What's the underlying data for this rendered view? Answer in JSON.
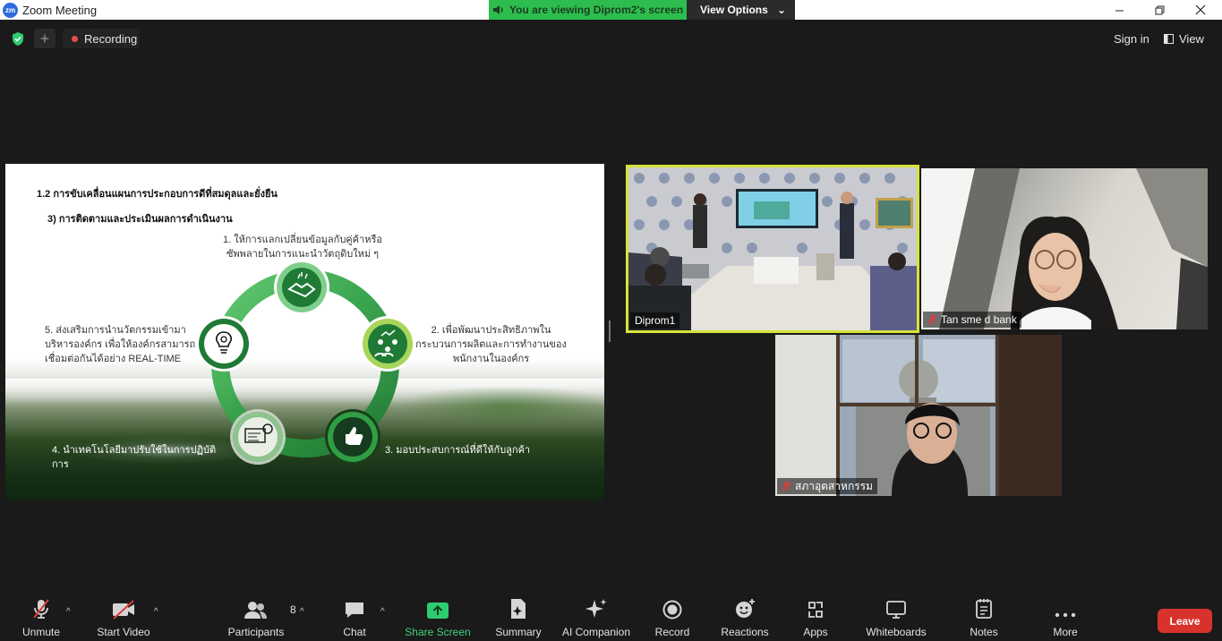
{
  "window": {
    "title": "Zoom Meeting",
    "logo_text": "zm",
    "banner_text": "You are viewing Diprom2's screen",
    "view_options_label": "View Options"
  },
  "topbar": {
    "recording_label": "Recording",
    "signin_label": "Sign in",
    "view_label": "View"
  },
  "slide": {
    "heading": "1.2 การขับเคลื่อนแผนการประกอบการดีที่สมดุลและยั่งยืน",
    "subheading": "3)  การติดตามและประเมินผลการดำเนินงาน",
    "items": [
      {
        "line1": "1. ให้การแลกเปลี่ยนข้อมูลกับคู่ค้าหรือ",
        "line2": "ซัพพลายในการแนะนำวัตถุดิบใหม่ ๆ"
      },
      {
        "line1": "2. เพื่อพัฒนาประสิทธิภาพใน",
        "line2": "กระบวนการผลิตและการทำงานของ",
        "line3": "พนักงานในองค์กร"
      },
      {
        "line1": "3. มอบประสบการณ์ที่ดีให้กับลูกค้า"
      },
      {
        "line1": "4. นำเทคโนโลยีมาปรับใช้ในการปฏิบัติการ"
      },
      {
        "line1": "5. ส่งเสริมการนำนวัตกรรมเข้ามา",
        "line2": "บริหารองค์กร เพื่อให้องค์กรสามารถ",
        "line3": "เชื่อมต่อกันได้อย่าง REAL-TIME"
      }
    ]
  },
  "participants_tiles": [
    {
      "name": "Diprom1",
      "muted": false
    },
    {
      "name": "Tan sme d bank",
      "muted": true
    },
    {
      "name": "สภาอุตสาหกรรม",
      "muted": true
    }
  ],
  "toolbar": {
    "unmute": "Unmute",
    "start_video": "Start Video",
    "participants": "Participants",
    "participants_count": "8",
    "chat": "Chat",
    "share_screen": "Share Screen",
    "summary": "Summary",
    "ai_companion": "AI Companion",
    "record": "Record",
    "reactions": "Reactions",
    "apps": "Apps",
    "whiteboards": "Whiteboards",
    "notes": "Notes",
    "more": "More",
    "leave": "Leave"
  },
  "colors": {
    "share_green": "#2dbd4e",
    "active_speaker": "#d6e33a",
    "leave_red": "#d8322d",
    "slide_green_dark": "#1f7a36",
    "slide_green_light": "#8cc63f"
  },
  "icons": [
    "shield-icon",
    "sparkle-icon",
    "record-dot-icon",
    "mic-muted-icon",
    "video-off-icon",
    "participants-icon",
    "chat-icon",
    "share-screen-icon",
    "summary-icon",
    "ai-companion-icon",
    "record-icon",
    "reactions-icon",
    "apps-icon",
    "whiteboard-icon",
    "notes-icon",
    "more-icon",
    "handshake-icon",
    "teamwork-icon",
    "thumbs-up-icon",
    "technology-icon",
    "innovation-bulb-icon"
  ]
}
